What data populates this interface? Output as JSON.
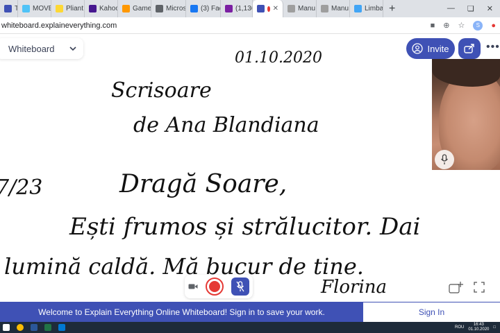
{
  "browser": {
    "tabs": [
      {
        "label": "Ta",
        "color": "#3f51b5"
      },
      {
        "label": "MOVE",
        "color": "#4fc3f7"
      },
      {
        "label": "Pliant",
        "color": "#fdd835"
      },
      {
        "label": "Kahoo",
        "color": "#46178f"
      },
      {
        "label": "Game",
        "color": "#ff9800"
      },
      {
        "label": "Micros",
        "color": "#5f6368"
      },
      {
        "label": "(3) Fac",
        "color": "#1877f2"
      },
      {
        "label": "(1,136",
        "color": "#7b1fa2"
      },
      {
        "label": "",
        "color": "#3f51b5",
        "active": true
      },
      {
        "label": "Manu",
        "color": "#9e9e9e"
      },
      {
        "label": "Manu",
        "color": "#9e9e9e"
      },
      {
        "label": "Limba",
        "color": "#42a5f5"
      }
    ],
    "new_tab": "+",
    "url": "whiteboard.explaineverything.com",
    "profile_initial": "S"
  },
  "app": {
    "board_name": "Whiteboard",
    "invite_label": "Invite",
    "more_label": "•••"
  },
  "handwriting": {
    "date": "01.10.2020",
    "title": "Scrisoare",
    "author": "de Ana Blandiana",
    "margin_note": "7/23",
    "line1": "Dragă Soare,",
    "line2": "Ești frumos și strălucitor. Dai",
    "line3": "lumină caldă. Mă bucur de tine.",
    "signature": "Florina"
  },
  "banner": {
    "message": "Welcome to Explain Everything Online Whiteboard! Sign in to save your work.",
    "signin_label": "Sign In"
  },
  "taskbar": {
    "lang": "ROU",
    "time": "16:43",
    "date": "01.10.2020"
  },
  "colors": {
    "accent": "#3f51b5",
    "record": "#e53935"
  }
}
